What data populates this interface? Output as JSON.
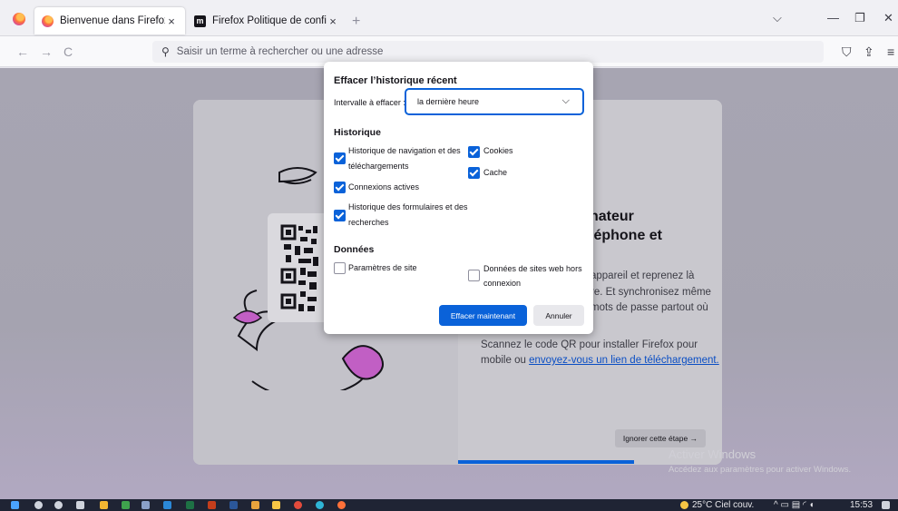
{
  "tabs": [
    {
      "title": "Bienvenue dans Firefox",
      "close": "×"
    },
    {
      "title": "Firefox Politique de confidentialité",
      "close": "×"
    }
  ],
  "tab_new": "+",
  "window_controls": {
    "list": "⌵",
    "minimize": "—",
    "maximize": "❐",
    "close": "✕"
  },
  "nav": {
    "back": "←",
    "forward": "→",
    "reload": "C"
  },
  "urlbar": {
    "placeholder": "Saisir un terme à rechercher ou une adresse"
  },
  "right_icons": {
    "pocket": "⛉",
    "share": "⇪",
    "menu": "≡"
  },
  "page": {
    "heading_line1": "nateur",
    "heading_line2": "léphone et",
    "body_lines": [
      "appareil et reprenez là",
      "re. Et synchronisez même",
      "mots de passe partout où"
    ],
    "scan_line1": "Scannez le code QR pour installer Firefox pour",
    "scan_line2_prefix": "mobile ou ",
    "scan_line2_link": "envoyez-vous un lien de téléchargement.",
    "skip_button": "Ignorer cette étape →"
  },
  "watermark": {
    "title": "Activer Windows",
    "subtitle": "Accédez aux paramètres pour activer Windows."
  },
  "dialog": {
    "title": "Effacer l’historique récent",
    "interval_label": "Intervalle à effacer :",
    "interval_value": "la dernière heure",
    "history_title": "Historique",
    "history_items": [
      {
        "label_line1": "Historique de navigation et des",
        "label_line2": "téléchargements",
        "checked": true
      },
      {
        "label_line1": "Connexions actives",
        "label_line2": "",
        "checked": true
      },
      {
        "label_line1": "Historique des formulaires et des",
        "label_line2": "recherches",
        "checked": true
      },
      {
        "label_line1": "Cookies",
        "label_line2": "",
        "checked": true
      },
      {
        "label_line1": "Cache",
        "label_line2": "",
        "checked": true
      }
    ],
    "data_title": "Données",
    "data_items": [
      {
        "label_line1": "Paramètres de site",
        "label_line2": "",
        "checked": false
      },
      {
        "label_line1": "Données de sites web hors",
        "label_line2": "connexion",
        "checked": false
      }
    ],
    "clear_button": "Effacer maintenant",
    "cancel_button": "Annuler"
  },
  "taskbar": {
    "weather": "25°C Ciel couv.",
    "time": "15:53"
  },
  "colors": {
    "accent": "#0a62d9",
    "taskbar": "#1f2434"
  }
}
